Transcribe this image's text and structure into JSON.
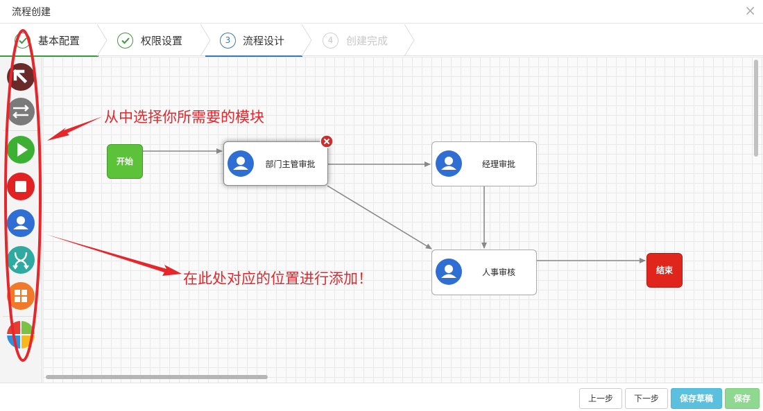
{
  "dialog": {
    "title": "流程创建",
    "close_glyph": "×"
  },
  "steps": [
    {
      "number": "1",
      "label": "基本配置",
      "state": "done",
      "icon": "check-icon"
    },
    {
      "number": "2",
      "label": "权限设置",
      "state": "done",
      "icon": "check-icon"
    },
    {
      "number": "3",
      "label": "流程设计",
      "state": "active"
    },
    {
      "number": "4",
      "label": "创建完成",
      "state": "todo"
    }
  ],
  "toolbar": {
    "tools": [
      {
        "name": "select-pointer-tool",
        "icon": "pointer-arrow-icon",
        "color": "#6b2a2a"
      },
      {
        "name": "connector-tool",
        "icon": "bidirectional-arrows-icon",
        "color": "#7a7a7a"
      },
      {
        "name": "start-node-tool",
        "icon": "play-icon",
        "color": "#3bb033"
      },
      {
        "name": "end-node-tool",
        "icon": "stop-square-icon",
        "color": "#e02222"
      },
      {
        "name": "task-node-tool",
        "icon": "user-icon",
        "color": "#2f6fd3"
      },
      {
        "name": "fork-node-tool",
        "icon": "fork-arrows-icon",
        "color": "#2eaaa0"
      },
      {
        "name": "join-node-tool",
        "icon": "grid-icon",
        "color": "#f07a2a"
      },
      {
        "name": "subprocess-tool",
        "icon": "multicolor-square-icon",
        "color": "#e8e8e8"
      }
    ]
  },
  "flow": {
    "start_label": "开始",
    "end_label": "结束",
    "nodes": [
      {
        "id": "dept",
        "label": "部门主管审批",
        "selected": true
      },
      {
        "id": "mgr",
        "label": "经理审批",
        "selected": false
      },
      {
        "id": "hr",
        "label": "人事审核",
        "selected": false
      }
    ]
  },
  "annotations": {
    "choose_module": "从中选择你所需要的模块",
    "add_here": "在此处对应的位置进行添加！"
  },
  "footer": {
    "prev": "上一步",
    "next": "下一步",
    "save_draft": "保存草稿",
    "save": "保存"
  },
  "colors": {
    "done_step": "#3a9a3a",
    "active_step": "#337ab7",
    "annotation_red": "#e5262b",
    "start_green": "#5cc23a",
    "end_red": "#e0261c"
  }
}
